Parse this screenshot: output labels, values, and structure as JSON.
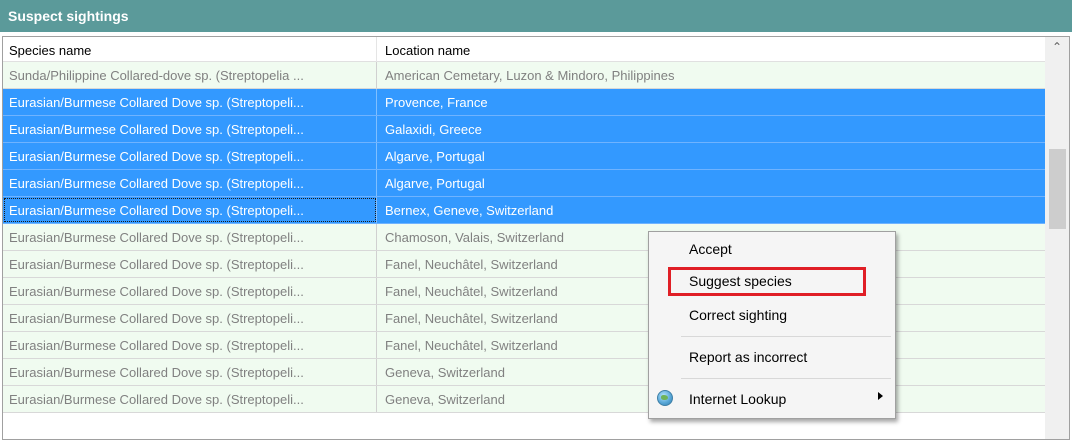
{
  "panel": {
    "title": "Suspect sightings"
  },
  "columns": {
    "species": "Species name",
    "location": "Location name"
  },
  "rows": [
    {
      "species": "Sunda/Philippine Collared-dove sp. (Streptopelia ...",
      "location": "American Cemetary, Luzon & Mindoro, Philippines",
      "selected": false
    },
    {
      "species": "Eurasian/Burmese Collared Dove sp. (Streptopeli...",
      "location": "Provence, France",
      "selected": true
    },
    {
      "species": "Eurasian/Burmese Collared Dove sp. (Streptopeli...",
      "location": "Galaxidi, Greece",
      "selected": true
    },
    {
      "species": "Eurasian/Burmese Collared Dove sp. (Streptopeli...",
      "location": "Algarve, Portugal",
      "selected": true
    },
    {
      "species": "Eurasian/Burmese Collared Dove sp. (Streptopeli...",
      "location": "Algarve, Portugal",
      "selected": true
    },
    {
      "species": "Eurasian/Burmese Collared Dove sp. (Streptopeli...",
      "location": "Bernex, Geneve, Switzerland",
      "selected": true,
      "focused": true
    },
    {
      "species": "Eurasian/Burmese Collared Dove sp. (Streptopeli...",
      "location": "Chamoson, Valais, Switzerland",
      "selected": false
    },
    {
      "species": "Eurasian/Burmese Collared Dove sp. (Streptopeli...",
      "location": "Fanel, Neuchâtel, Switzerland",
      "selected": false
    },
    {
      "species": "Eurasian/Burmese Collared Dove sp. (Streptopeli...",
      "location": "Fanel, Neuchâtel, Switzerland",
      "selected": false
    },
    {
      "species": "Eurasian/Burmese Collared Dove sp. (Streptopeli...",
      "location": "Fanel, Neuchâtel, Switzerland",
      "selected": false
    },
    {
      "species": "Eurasian/Burmese Collared Dove sp. (Streptopeli...",
      "location": "Fanel, Neuchâtel, Switzerland",
      "selected": false
    },
    {
      "species": "Eurasian/Burmese Collared Dove sp. (Streptopeli...",
      "location": "Geneva, Switzerland",
      "selected": false
    },
    {
      "species": "Eurasian/Burmese Collared Dove sp. (Streptopeli...",
      "location": "Geneva, Switzerland",
      "selected": false
    }
  ],
  "context_menu": {
    "accept": "Accept",
    "suggest_species": "Suggest species",
    "correct_sighting": "Correct sighting",
    "report_incorrect": "Report as incorrect",
    "internet_lookup": "Internet Lookup",
    "lookup_icon": "globe-icon",
    "highlighted_item": "Suggest species",
    "highlight_color": "#e01f26"
  },
  "colors": {
    "header_bg": "#5b9a9a",
    "row_bg": "#f0fbf0",
    "selected_bg": "#3399ff"
  }
}
